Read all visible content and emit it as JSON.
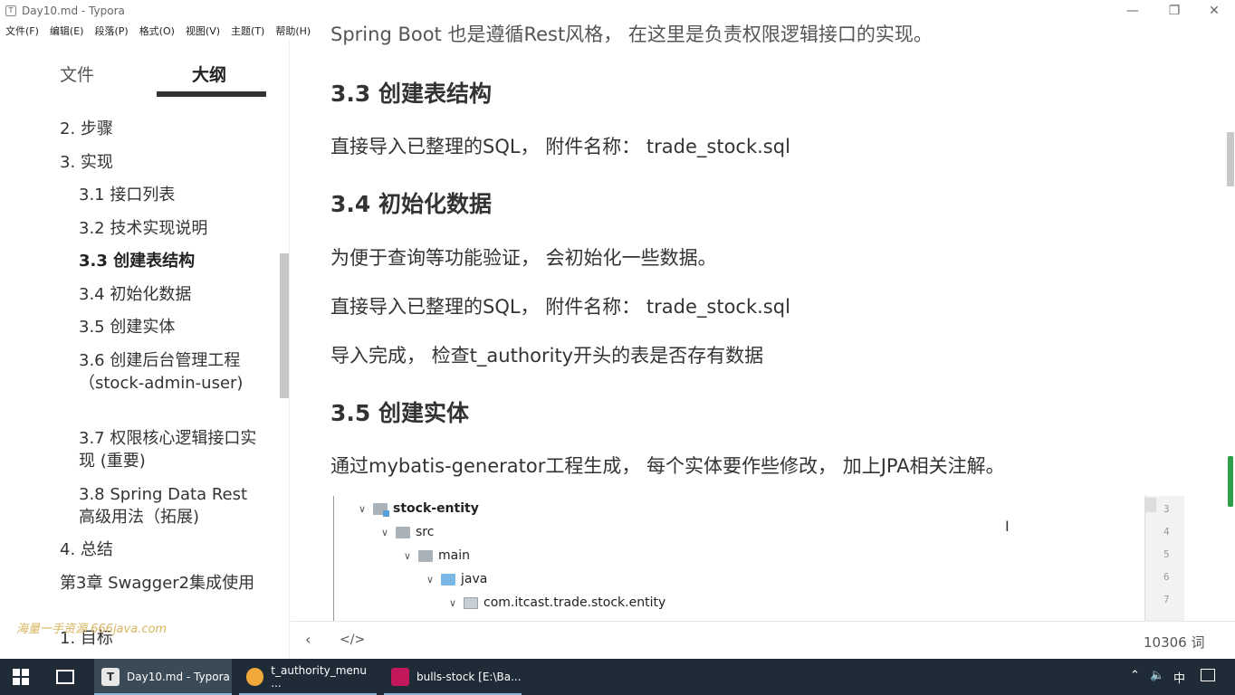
{
  "window": {
    "title": "Day10.md - Typora",
    "app_icon": "T"
  },
  "menu": [
    "文件(F)",
    "编辑(E)",
    "段落(P)",
    "格式(O)",
    "视图(V)",
    "主题(T)",
    "帮助(H)"
  ],
  "sidebar": {
    "tabs": {
      "files": "文件",
      "outline": "大纲"
    },
    "outline": [
      {
        "label": "2. 步骤",
        "level": 1
      },
      {
        "label": "3. 实现",
        "level": 1
      },
      {
        "label": "3.1 接口列表",
        "level": 2
      },
      {
        "label": "3.2 技术实现说明",
        "level": 2
      },
      {
        "label": "3.3 创建表结构",
        "level": 2,
        "active": true
      },
      {
        "label": "3.4 初始化数据",
        "level": 2
      },
      {
        "label": "3.5 创建实体",
        "level": 2
      },
      {
        "label": "3.6 创建后台管理工程（stock-admin-user)",
        "level": 2
      },
      {
        "label": "3.7 权限核心逻辑接口实现 (重要)",
        "level": 2
      },
      {
        "label": "3.8 Spring Data Rest 高级用法（拓展)",
        "level": 2
      },
      {
        "label": "4. 总结",
        "level": 1
      },
      {
        "label": "第3章 Swagger2集成使用",
        "level": 1
      },
      {
        "label": "1. 目标",
        "level": 1
      }
    ],
    "watermark": "海量一手资源 666java.com"
  },
  "content": {
    "cut_line": "Spring Boot 也是遵循Rest风格， 在这里是负责权限逻辑接口的实现。",
    "h_33": "3.3 创建表结构",
    "p_33": "直接导入已整理的SQL， 附件名称： trade_stock.sql",
    "h_34": "3.4 初始化数据",
    "p_34a": "为便于查询等功能验证， 会初始化一些数据。",
    "p_34b": "直接导入已整理的SQL， 附件名称： trade_stock.sql",
    "p_34c": "导入完成， 检查t_authority开头的表是否存有数据",
    "h_35": "3.5 创建实体",
    "p_35": "通过mybatis-generator工程生成， 每个实体要作些修改， 加上JPA相关注解。"
  },
  "ide_tree": [
    {
      "name": "stock-entity",
      "depth": 0,
      "icon": "module-folder-icon",
      "bold": true
    },
    {
      "name": "src",
      "depth": 1,
      "icon": "folder-icon"
    },
    {
      "name": "main",
      "depth": 2,
      "icon": "folder-icon"
    },
    {
      "name": "java",
      "depth": 3,
      "icon": "source-folder-icon"
    },
    {
      "name": "com.itcast.trade.stock.entity",
      "depth": 4,
      "icon": "package-icon"
    }
  ],
  "ide_gutter": [
    "3",
    "4",
    "5",
    "6",
    "7"
  ],
  "footer": {
    "back": "‹",
    "source": "</>",
    "wordcount": "10306 词"
  },
  "taskbar": {
    "tasks": [
      {
        "label": "Day10.md - Typora",
        "color": "#e8e8e8",
        "active": true
      },
      {
        "label": "t_authority_menu ...",
        "color": "#f2a93b",
        "active": false
      },
      {
        "label": "bulls-stock [E:\\Ba...",
        "color": "#c2185b",
        "active": false
      }
    ],
    "tray": {
      "ime": "中"
    }
  }
}
